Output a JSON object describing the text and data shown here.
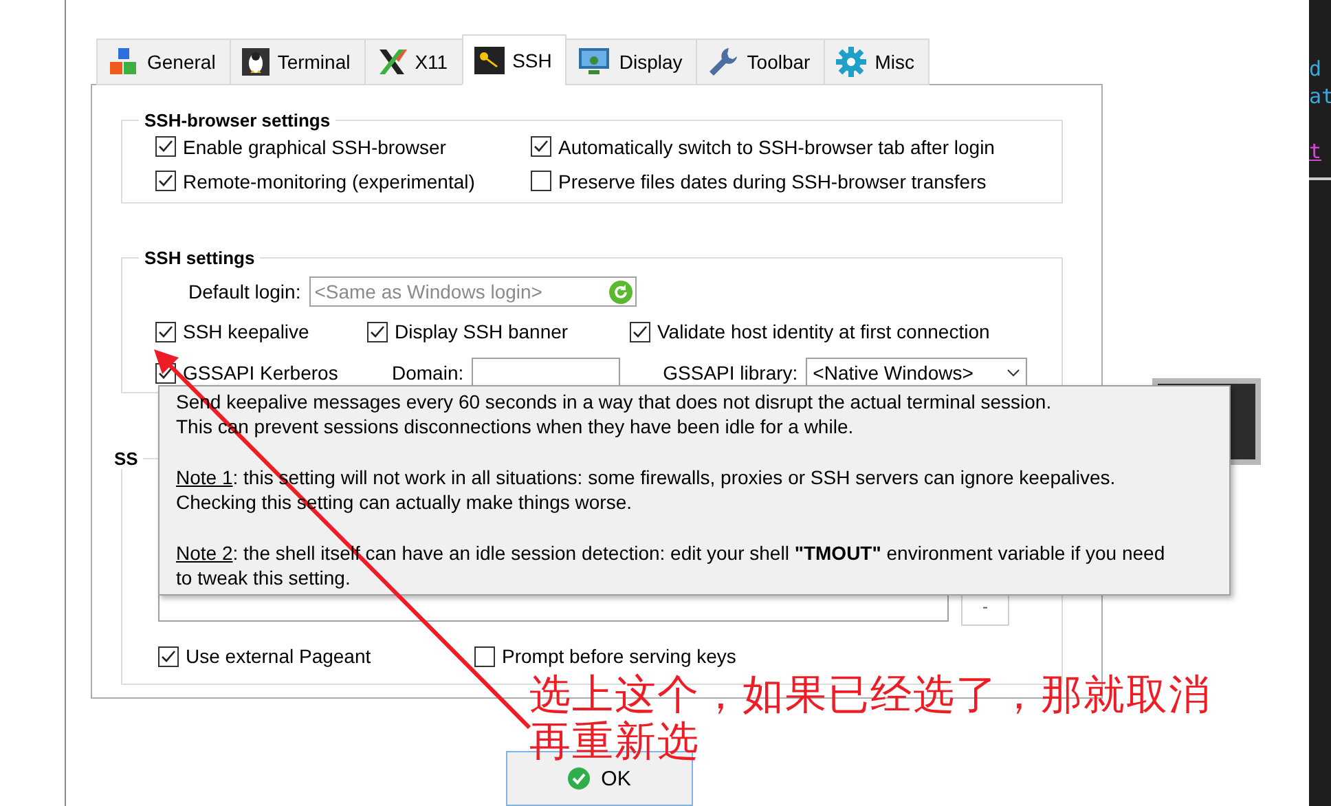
{
  "tabs": [
    {
      "label": "General",
      "selected": false
    },
    {
      "label": "Terminal",
      "selected": false
    },
    {
      "label": "X11",
      "selected": false
    },
    {
      "label": "SSH",
      "selected": true
    },
    {
      "label": "Display",
      "selected": false
    },
    {
      "label": "Toolbar",
      "selected": false
    },
    {
      "label": "Misc",
      "selected": false
    }
  ],
  "browser_settings": {
    "title": "SSH-browser settings",
    "options": [
      {
        "label": "Enable graphical SSH-browser",
        "checked": true
      },
      {
        "label": "Automatically switch to SSH-browser tab after login",
        "checked": true
      },
      {
        "label": "Remote-monitoring (experimental)",
        "checked": true
      },
      {
        "label": "Preserve files dates during SSH-browser transfers",
        "checked": false
      }
    ]
  },
  "ssh_settings": {
    "title": "SSH settings",
    "default_login": {
      "label": "Default login:",
      "placeholder": "<Same as Windows login>"
    },
    "options": [
      {
        "label": "SSH keepalive",
        "checked": true
      },
      {
        "label": "Display SSH banner",
        "checked": true
      },
      {
        "label": "Validate host identity at first connection",
        "checked": true
      }
    ],
    "gssapi": {
      "label": "GSSAPI Kerberos",
      "checked": true,
      "domain_label": "Domain:",
      "library_label": "GSSAPI library:",
      "library_value": "<Native Windows>"
    }
  },
  "agent_settings": {
    "title": "SS",
    "remove_button": "-",
    "options": [
      {
        "label": "Use external Pageant",
        "checked": true
      },
      {
        "label": "Prompt before serving keys",
        "checked": false
      }
    ]
  },
  "tooltip": {
    "paragraphs": [
      {
        "lines": [
          {
            "text": "Send keepalive messages every 60 seconds in a way that does not disrupt the actual terminal session."
          },
          {
            "text": "This can prevent sessions disconnections when they have been idle for a while."
          }
        ]
      },
      {
        "lines": [
          {
            "note": "Note 1",
            "text": ": this setting will not work in all situations: some firewalls, proxies or SSH servers can ignore keepalives."
          },
          {
            "text": "Checking this setting can actually make things worse."
          }
        ]
      },
      {
        "lines": [
          {
            "note": "Note 2",
            "text": ": the shell itself can have an idle session detection: edit your shell **\"TMOUT\"** environment variable if you need"
          },
          {
            "text": "to tweak this setting."
          }
        ]
      }
    ]
  },
  "annotation": {
    "lines": [
      "选上这个，如果已经选了，那就取消",
      "再重新选"
    ]
  },
  "ok_button": "OK",
  "terminal_lines": [
    {
      "text": "d",
      "kind": "code"
    },
    {
      "text": "at",
      "kind": "code"
    },
    {
      "text": "t",
      "kind": "link"
    }
  ]
}
